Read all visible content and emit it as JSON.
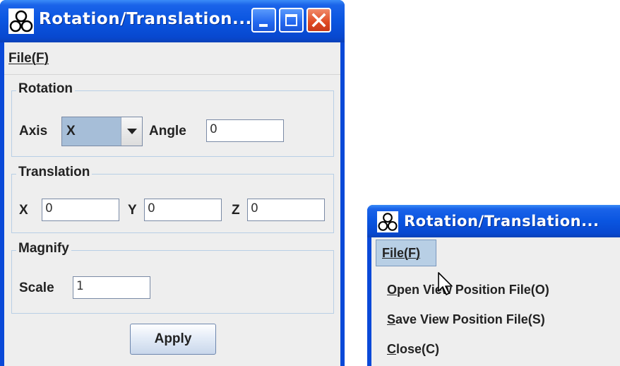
{
  "main_window": {
    "title": "Rotation/Translation...",
    "menu": {
      "file_label": "File(F)"
    },
    "rotation": {
      "legend": "Rotation",
      "axis_label": "Axis",
      "axis_value": "X",
      "angle_label": "Angle",
      "angle_value": "0"
    },
    "translation": {
      "legend": "Translation",
      "x_label": "X",
      "x_value": "0",
      "y_label": "Y",
      "y_value": "0",
      "z_label": "Z",
      "z_value": "0"
    },
    "magnify": {
      "legend": "Magnify",
      "scale_label": "Scale",
      "scale_value": "1"
    },
    "apply_label": "Apply"
  },
  "menu_window": {
    "title": "Rotation/Translation...",
    "file_label": "File(F)",
    "items": [
      {
        "label": "Open View Position File(O)"
      },
      {
        "label": "Save View Position File(S)"
      },
      {
        "label": "Close(C)"
      }
    ]
  },
  "icons": {
    "app": "java-app-icon",
    "minimize": "minimize-icon",
    "maximize": "maximize-icon",
    "close": "close-icon",
    "dropdown": "chevron-down-icon",
    "cursor": "mouse-cursor-icon"
  },
  "colors": {
    "titlebar": "#0a55e0",
    "client": "#eeeeee",
    "group_border": "#b8cfe5",
    "close_button": "#df4a22",
    "menu_highlight": "#b8cfe5"
  }
}
